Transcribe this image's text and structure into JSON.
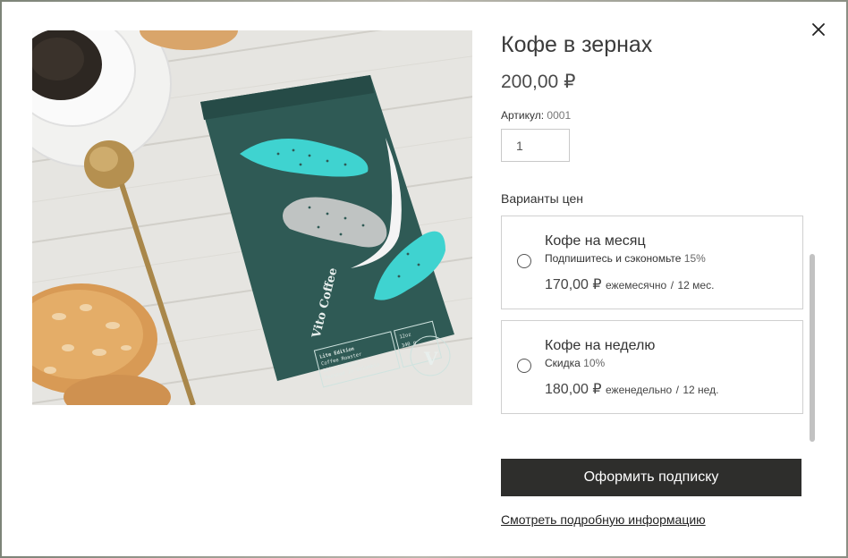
{
  "product": {
    "title": "Кофе в зернах",
    "price": "200,00 ₽",
    "sku_label": "Артикул:",
    "sku_value": "0001",
    "quantity": "1"
  },
  "image": {
    "bag_brand": "Vito Coffee",
    "bag_edition": "Lite Edition",
    "bag_line1": "Coffee Roaster",
    "bag_line2": "100% Arabica",
    "bag_line3": "Roasted In Colombia",
    "bag_weight1": "12oz",
    "bag_weight2": "340 g",
    "bag_logo_letter": "V"
  },
  "plans": {
    "label": "Варианты цен",
    "items": [
      {
        "name": "Кофе на месяц",
        "desc": "Подпишитесь и сэкономьте",
        "discount": "15%",
        "amount": "170,00 ₽",
        "period": "ежемесячно",
        "sep": "/",
        "duration": "12 мес."
      },
      {
        "name": "Кофе на неделю",
        "desc": "Скидка",
        "discount": "10%",
        "amount": "180,00 ₽",
        "period": "еженедельно",
        "sep": "/",
        "duration": "12 нед."
      }
    ]
  },
  "actions": {
    "subscribe": "Оформить подписку",
    "details_link": "Смотреть подробную информацию"
  },
  "colors": {
    "primary_button": "#2e2e2c",
    "bag_green": "#2f5a55",
    "bag_accent": "#3fd3d0"
  }
}
